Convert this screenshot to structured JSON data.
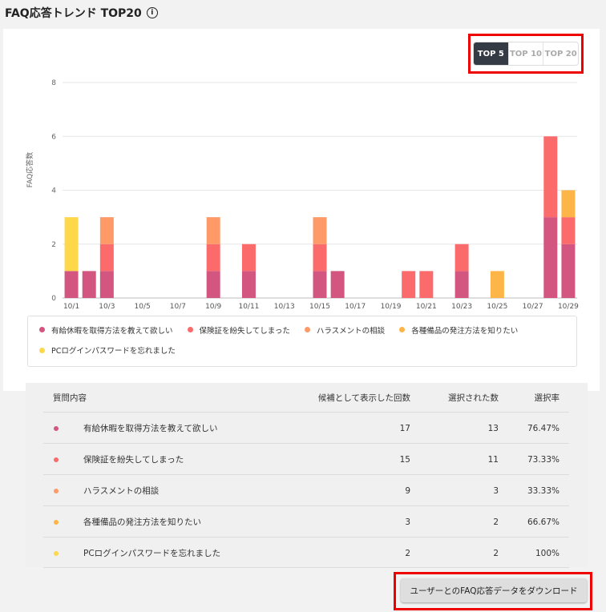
{
  "header": {
    "title": "FAQ応答トレンド TOP20",
    "info_icon": "info-circle-icon"
  },
  "filter": {
    "options": [
      {
        "label": "TOP 5",
        "active": true
      },
      {
        "label": "TOP 10",
        "active": false
      },
      {
        "label": "TOP 20",
        "active": false
      }
    ]
  },
  "chart_data": {
    "type": "bar",
    "stacked": true,
    "ylabel": "FAQ応答数",
    "xlabel": "",
    "ylim": [
      0,
      8
    ],
    "yticks": [
      0,
      2,
      4,
      6,
      8
    ],
    "grid": true,
    "categories": [
      "10/1",
      "10/2",
      "10/3",
      "10/4",
      "10/5",
      "10/6",
      "10/7",
      "10/8",
      "10/9",
      "10/10",
      "10/11",
      "10/12",
      "10/13",
      "10/14",
      "10/15",
      "10/16",
      "10/17",
      "10/18",
      "10/19",
      "10/20",
      "10/21",
      "10/22",
      "10/23",
      "10/24",
      "10/25",
      "10/26",
      "10/27",
      "10/28",
      "10/29"
    ],
    "tick_labels": [
      "10/1",
      "10/3",
      "10/5",
      "10/7",
      "10/9",
      "10/11",
      "10/13",
      "10/15",
      "10/17",
      "10/19",
      "10/21",
      "10/23",
      "10/25",
      "10/27",
      "10/29"
    ],
    "series": [
      {
        "name": "有給休暇を取得方法を教えて欲しい",
        "color": "#d25680",
        "values": [
          1,
          1,
          1,
          0,
          0,
          0,
          0,
          0,
          1,
          0,
          1,
          0,
          0,
          0,
          1,
          1,
          0,
          0,
          0,
          0,
          0,
          0,
          1,
          0,
          0,
          0,
          0,
          3,
          2
        ]
      },
      {
        "name": "保険証を紛失してしまった",
        "color": "#fc6b6b",
        "values": [
          0,
          0,
          1,
          0,
          0,
          0,
          0,
          0,
          1,
          0,
          1,
          0,
          0,
          0,
          1,
          0,
          0,
          0,
          0,
          1,
          1,
          0,
          1,
          0,
          0,
          0,
          0,
          3,
          1
        ]
      },
      {
        "name": "ハラスメントの相談",
        "color": "#fd9a68",
        "values": [
          0,
          0,
          1,
          0,
          0,
          0,
          0,
          0,
          1,
          0,
          0,
          0,
          0,
          0,
          1,
          0,
          0,
          0,
          0,
          0,
          0,
          0,
          0,
          0,
          0,
          0,
          0,
          0,
          0
        ]
      },
      {
        "name": "各種備品の発注方法を知りたい",
        "color": "#fdb548",
        "values": [
          0,
          0,
          0,
          0,
          0,
          0,
          0,
          0,
          0,
          0,
          0,
          0,
          0,
          0,
          0,
          0,
          0,
          0,
          0,
          0,
          0,
          0,
          0,
          0,
          1,
          0,
          0,
          0,
          1
        ]
      },
      {
        "name": "PCログインパスワードを忘れました",
        "color": "#fcd84a",
        "values": [
          2,
          0,
          0,
          0,
          0,
          0,
          0,
          0,
          0,
          0,
          0,
          0,
          0,
          0,
          0,
          0,
          0,
          0,
          0,
          0,
          0,
          0,
          0,
          0,
          0,
          0,
          0,
          0,
          0
        ]
      }
    ],
    "legend_position": "bottom"
  },
  "table": {
    "headers": {
      "question": "質問内容",
      "shown": "候補として表示した回数",
      "selected": "選択された数",
      "rate": "選択率"
    },
    "rows": [
      {
        "question": "有給休暇を取得方法を教えて欲しい",
        "color": "#d25680",
        "shown": "17",
        "selected": "13",
        "rate": "76.47%"
      },
      {
        "question": "保険証を紛失してしまった",
        "color": "#fc6b6b",
        "shown": "15",
        "selected": "11",
        "rate": "73.33%"
      },
      {
        "question": "ハラスメントの相談",
        "color": "#fd9a68",
        "shown": "9",
        "selected": "3",
        "rate": "33.33%"
      },
      {
        "question": "各種備品の発注方法を知りたい",
        "color": "#fdb548",
        "shown": "3",
        "selected": "2",
        "rate": "66.67%"
      },
      {
        "question": "PCログインパスワードを忘れました",
        "color": "#fcd84a",
        "shown": "2",
        "selected": "2",
        "rate": "100%"
      }
    ]
  },
  "download": {
    "label": "ユーザーとのFAQ応答データをダウンロード"
  }
}
